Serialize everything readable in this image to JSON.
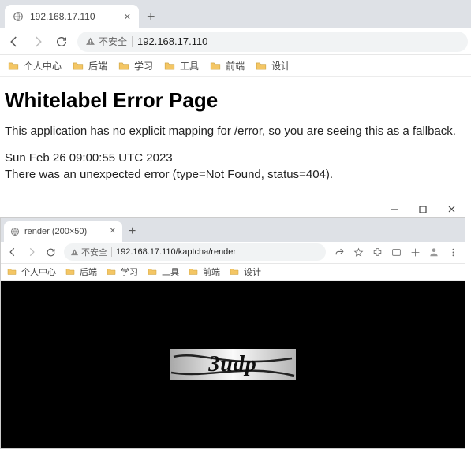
{
  "win1": {
    "tab": {
      "title": "192.168.17.110"
    },
    "toolbar": {
      "secure_label": "不安全",
      "url": "192.168.17.110"
    },
    "bookmarks": [
      "个人中心",
      "后端",
      "学习",
      "工具",
      "前端",
      "设计"
    ],
    "page": {
      "heading": "Whitelabel Error Page",
      "line1": "This application has no explicit mapping for /error, so you are seeing this as a fallback.",
      "timestamp": "Sun Feb 26 09:00:55 UTC 2023",
      "line2": "There was an unexpected error (type=Not Found, status=404)."
    }
  },
  "win2": {
    "tab": {
      "title": "render (200×50)"
    },
    "toolbar": {
      "secure_label": "不安全",
      "url": "192.168.17.110/kaptcha/render"
    },
    "bookmarks": [
      "个人中心",
      "后端",
      "学习",
      "工具",
      "前端",
      "设计"
    ],
    "captcha_text": "3udp"
  }
}
